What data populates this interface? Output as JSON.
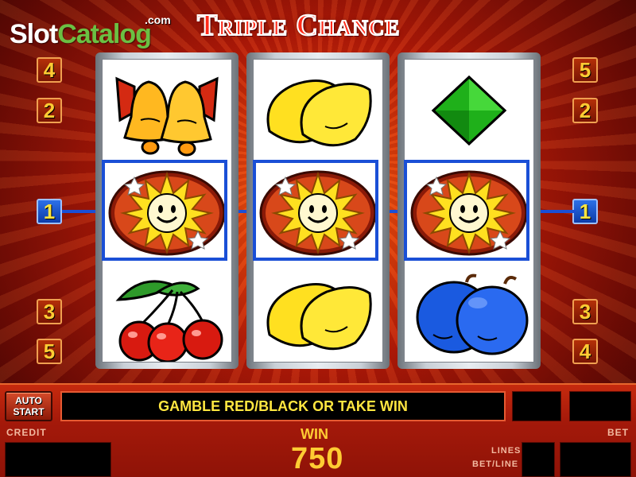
{
  "logo": {
    "slot": "Slot",
    "catalog": "Catalog",
    "com": ".com"
  },
  "title": "Triple Chance",
  "line_badges": {
    "left": [
      "4",
      "2",
      "1",
      "3",
      "5"
    ],
    "right": [
      "5",
      "2",
      "1",
      "3",
      "4"
    ],
    "active_line": "1"
  },
  "reels": [
    [
      "bells-icon",
      "sun-icon",
      "cherries-icon"
    ],
    [
      "lemons-icon",
      "sun-icon",
      "lemons-icon"
    ],
    [
      "diamond-icon",
      "sun-icon",
      "plums-icon"
    ]
  ],
  "panel": {
    "auto_start_line1": "AUTO",
    "auto_start_line2": "START",
    "message": "GAMBLE RED/BLACK OR TAKE WIN",
    "credit_label": "CREDIT",
    "win_label": "WIN",
    "win_value": "750",
    "lines_label": "LINES",
    "bet_line_label": "BET/LINE",
    "bet_label": "BET"
  },
  "colors": {
    "payline": "#1a4fd6",
    "badge_red": "#b43008",
    "badge_blue": "#2c70e8",
    "win_text": "#ffcc33",
    "message_text": "#ffe640"
  }
}
